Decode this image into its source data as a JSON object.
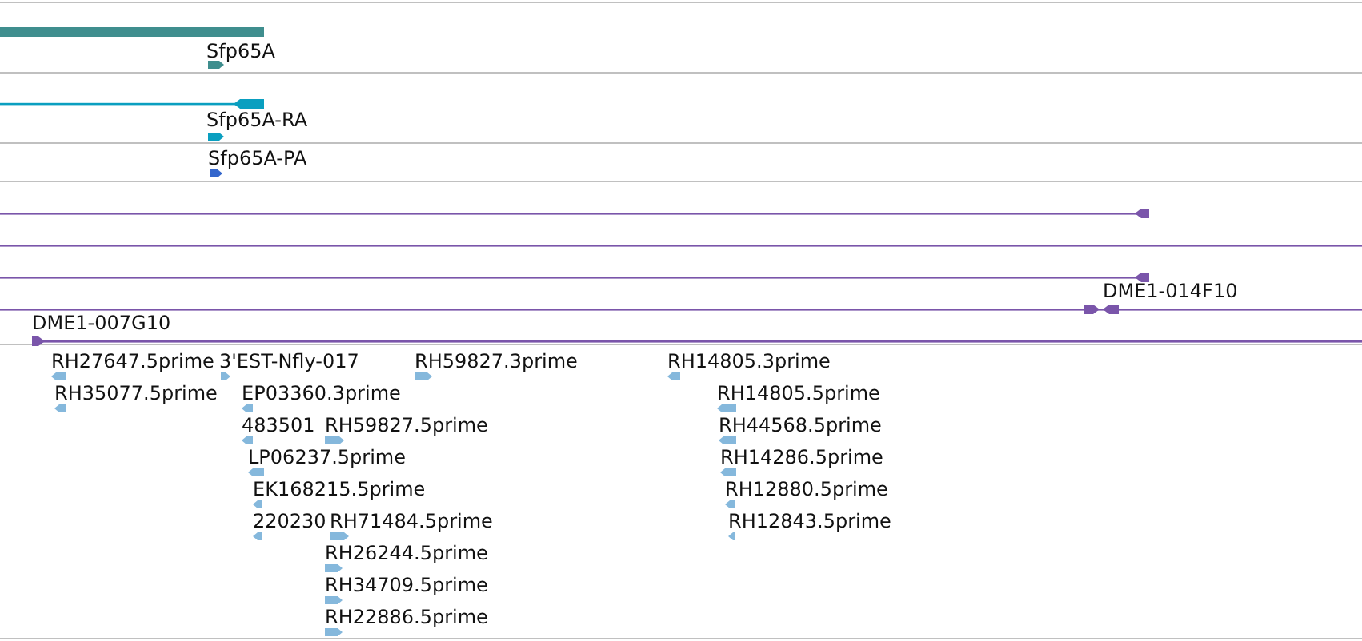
{
  "tracks": [
    {
      "kind": "gene",
      "features": [
        {
          "label": "Sfp65A",
          "forward": true
        }
      ]
    },
    {
      "kind": "transcript",
      "features": [
        {
          "label": "Sfp65A-RA",
          "forward": true
        }
      ]
    },
    {
      "kind": "protein",
      "features": [
        {
          "label": "Sfp65A-PA",
          "forward": true
        }
      ]
    },
    {
      "kind": "clone",
      "features": [
        {
          "label": "DME1-014F10"
        },
        {
          "label": "DME1-007G10"
        }
      ]
    },
    {
      "kind": "est",
      "features": [
        {
          "label": "RH27647.5prime",
          "forward": false
        },
        {
          "label": "3'EST-Nfly-017",
          "forward": true
        },
        {
          "label": "RH59827.3prime",
          "forward": true
        },
        {
          "label": "RH14805.3prime",
          "forward": false
        },
        {
          "label": "RH35077.5prime",
          "forward": false
        },
        {
          "label": "EP03360.3prime",
          "forward": false
        },
        {
          "label": "RH14805.5prime",
          "forward": false
        },
        {
          "label": "483501",
          "forward": false
        },
        {
          "label": "RH59827.5prime",
          "forward": true
        },
        {
          "label": "RH44568.5prime",
          "forward": false
        },
        {
          "label": "LP06237.5prime",
          "forward": false
        },
        {
          "label": "RH14286.5prime",
          "forward": false
        },
        {
          "label": "EK168215.5prime",
          "forward": false
        },
        {
          "label": "RH12880.5prime",
          "forward": false
        },
        {
          "label": "220230",
          "forward": false
        },
        {
          "label": "RH71484.5prime",
          "forward": true
        },
        {
          "label": "RH12843.5prime",
          "forward": false
        },
        {
          "label": "RH26244.5prime",
          "forward": true
        },
        {
          "label": "RH34709.5prime",
          "forward": true
        },
        {
          "label": "RH22886.5prime",
          "forward": true
        }
      ]
    }
  ]
}
